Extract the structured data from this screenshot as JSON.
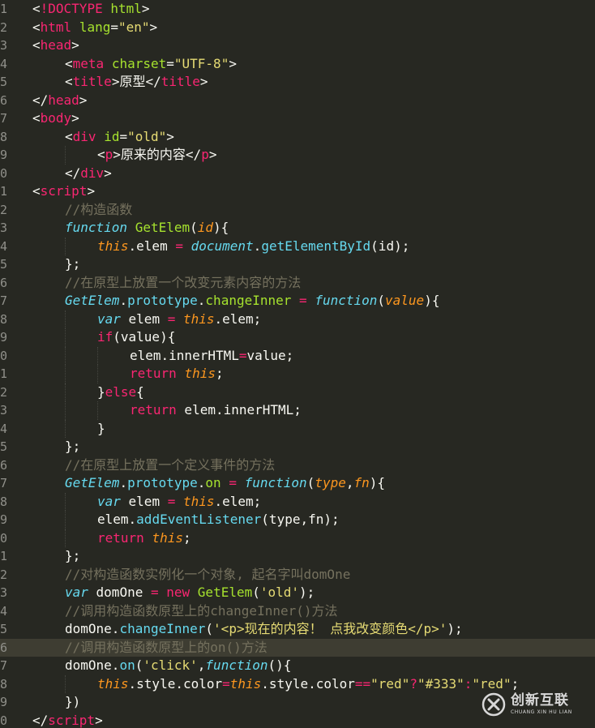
{
  "editor": {
    "theme_colors": {
      "background": "#272822",
      "active_line": "#3e3d32",
      "tag": "#f92672",
      "attribute": "#a6e22e",
      "string": "#e6db74",
      "comment": "#75715e",
      "storage": "#66d9ef",
      "parameter": "#fd971f"
    },
    "active_line_index": 35,
    "lines": [
      {
        "n": "1",
        "tokens": [
          [
            "punct",
            "<"
          ],
          [
            "tag",
            "!DOCTYPE"
          ],
          [
            "punct",
            " "
          ],
          [
            "attr",
            "html"
          ],
          [
            "punct",
            ">"
          ]
        ]
      },
      {
        "n": "2",
        "tokens": [
          [
            "punct",
            "<"
          ],
          [
            "tag",
            "html"
          ],
          [
            "punct",
            " "
          ],
          [
            "attr",
            "lang"
          ],
          [
            "punct",
            "="
          ],
          [
            "str",
            "\"en\""
          ],
          [
            "punct",
            ">"
          ]
        ]
      },
      {
        "n": "3",
        "tokens": [
          [
            "punct",
            "<"
          ],
          [
            "tag",
            "head"
          ],
          [
            "punct",
            ">"
          ]
        ]
      },
      {
        "n": "4",
        "indent": 1,
        "tokens": [
          [
            "punct",
            "<"
          ],
          [
            "tag",
            "meta"
          ],
          [
            "punct",
            " "
          ],
          [
            "attr",
            "charset"
          ],
          [
            "punct",
            "="
          ],
          [
            "str",
            "\"UTF-8\""
          ],
          [
            "punct",
            ">"
          ]
        ]
      },
      {
        "n": "5",
        "indent": 1,
        "tokens": [
          [
            "punct",
            "<"
          ],
          [
            "tag",
            "title"
          ],
          [
            "punct",
            ">原型</"
          ],
          [
            "tag",
            "title"
          ],
          [
            "punct",
            ">"
          ]
        ]
      },
      {
        "n": "6",
        "tokens": [
          [
            "punct",
            "</"
          ],
          [
            "tag",
            "head"
          ],
          [
            "punct",
            ">"
          ]
        ]
      },
      {
        "n": "7",
        "tokens": [
          [
            "punct",
            "<"
          ],
          [
            "tag",
            "body"
          ],
          [
            "punct",
            ">"
          ]
        ]
      },
      {
        "n": "8",
        "indent": 1,
        "tokens": [
          [
            "punct",
            "<"
          ],
          [
            "tag",
            "div"
          ],
          [
            "punct",
            " "
          ],
          [
            "attr",
            "id"
          ],
          [
            "punct",
            "="
          ],
          [
            "str",
            "\"old\""
          ],
          [
            "punct",
            ">"
          ]
        ]
      },
      {
        "n": "9",
        "indent": 2,
        "tokens": [
          [
            "punct",
            "<"
          ],
          [
            "tag",
            "p"
          ],
          [
            "punct",
            ">原来的内容</"
          ],
          [
            "tag",
            "p"
          ],
          [
            "punct",
            ">"
          ]
        ]
      },
      {
        "n": "0",
        "indent": 1,
        "tokens": [
          [
            "punct",
            "</"
          ],
          [
            "tag",
            "div"
          ],
          [
            "punct",
            ">"
          ]
        ]
      },
      {
        "n": "1",
        "tokens": [
          [
            "punct",
            "<"
          ],
          [
            "tag",
            "script"
          ],
          [
            "punct",
            ">"
          ]
        ]
      },
      {
        "n": "2",
        "indent": 1,
        "tokens": [
          [
            "cm",
            "//构造函数"
          ]
        ]
      },
      {
        "n": "3",
        "indent": 1,
        "tokens": [
          [
            "sto",
            "function"
          ],
          [
            "punct",
            " "
          ],
          [
            "fn",
            "GetElem"
          ],
          [
            "punct",
            "("
          ],
          [
            "param",
            "id"
          ],
          [
            "punct",
            "){"
          ]
        ]
      },
      {
        "n": "4",
        "indent": 2,
        "tokens": [
          [
            "this",
            "this"
          ],
          [
            "punct",
            ".elem "
          ],
          [
            "kw",
            "="
          ],
          [
            "punct",
            " "
          ],
          [
            "cls",
            "document"
          ],
          [
            "punct",
            "."
          ],
          [
            "sup",
            "getElementById"
          ],
          [
            "punct",
            "(id);"
          ]
        ]
      },
      {
        "n": "5",
        "indent": 1,
        "tokens": [
          [
            "punct",
            "};"
          ]
        ]
      },
      {
        "n": "6",
        "indent": 1,
        "tokens": [
          [
            "cm",
            "//在原型上放置一个改变元素内容的方法"
          ]
        ]
      },
      {
        "n": "7",
        "indent": 1,
        "tokens": [
          [
            "cls",
            "GetElem"
          ],
          [
            "punct",
            "."
          ],
          [
            "sup",
            "prototype"
          ],
          [
            "punct",
            "."
          ],
          [
            "fn",
            "changeInner"
          ],
          [
            "punct",
            " "
          ],
          [
            "kw",
            "="
          ],
          [
            "punct",
            " "
          ],
          [
            "sto",
            "function"
          ],
          [
            "punct",
            "("
          ],
          [
            "param",
            "value"
          ],
          [
            "punct",
            "){"
          ]
        ]
      },
      {
        "n": "8",
        "indent": 2,
        "tokens": [
          [
            "sto",
            "var"
          ],
          [
            "punct",
            " elem "
          ],
          [
            "kw",
            "="
          ],
          [
            "punct",
            " "
          ],
          [
            "this",
            "this"
          ],
          [
            "punct",
            ".elem;"
          ]
        ]
      },
      {
        "n": "9",
        "indent": 2,
        "tokens": [
          [
            "kw",
            "if"
          ],
          [
            "punct",
            "(value){"
          ]
        ]
      },
      {
        "n": "0",
        "indent": 3,
        "tokens": [
          [
            "punct",
            "elem.innerHTML"
          ],
          [
            "kw",
            "="
          ],
          [
            "punct",
            "value;"
          ]
        ]
      },
      {
        "n": "1",
        "indent": 3,
        "tokens": [
          [
            "kw",
            "return"
          ],
          [
            "punct",
            " "
          ],
          [
            "this",
            "this"
          ],
          [
            "punct",
            ";"
          ]
        ]
      },
      {
        "n": "2",
        "indent": 2,
        "tokens": [
          [
            "punct",
            "}"
          ],
          [
            "kw",
            "else"
          ],
          [
            "punct",
            "{"
          ]
        ]
      },
      {
        "n": "3",
        "indent": 3,
        "tokens": [
          [
            "kw",
            "return"
          ],
          [
            "punct",
            " elem.innerHTML;"
          ]
        ]
      },
      {
        "n": "4",
        "indent": 2,
        "tokens": [
          [
            "punct",
            "}"
          ]
        ]
      },
      {
        "n": "5",
        "indent": 1,
        "tokens": [
          [
            "punct",
            "};"
          ]
        ]
      },
      {
        "n": "6",
        "indent": 1,
        "tokens": [
          [
            "cm",
            "//在原型上放置一个定义事件的方法"
          ]
        ]
      },
      {
        "n": "7",
        "indent": 1,
        "tokens": [
          [
            "cls",
            "GetElem"
          ],
          [
            "punct",
            "."
          ],
          [
            "sup",
            "prototype"
          ],
          [
            "punct",
            "."
          ],
          [
            "fn",
            "on"
          ],
          [
            "punct",
            " "
          ],
          [
            "kw",
            "="
          ],
          [
            "punct",
            " "
          ],
          [
            "sto",
            "function"
          ],
          [
            "punct",
            "("
          ],
          [
            "param",
            "type"
          ],
          [
            "punct",
            ","
          ],
          [
            "param",
            "fn"
          ],
          [
            "punct",
            "){"
          ]
        ]
      },
      {
        "n": "8",
        "indent": 2,
        "tokens": [
          [
            "sto",
            "var"
          ],
          [
            "punct",
            " elem "
          ],
          [
            "kw",
            "="
          ],
          [
            "punct",
            " "
          ],
          [
            "this",
            "this"
          ],
          [
            "punct",
            ".elem;"
          ]
        ]
      },
      {
        "n": "9",
        "indent": 2,
        "tokens": [
          [
            "punct",
            "elem."
          ],
          [
            "sup",
            "addEventListener"
          ],
          [
            "punct",
            "(type,fn);"
          ]
        ]
      },
      {
        "n": "0",
        "indent": 2,
        "tokens": [
          [
            "kw",
            "return"
          ],
          [
            "punct",
            " "
          ],
          [
            "this",
            "this"
          ],
          [
            "punct",
            ";"
          ]
        ]
      },
      {
        "n": "1",
        "indent": 1,
        "tokens": [
          [
            "punct",
            "};"
          ]
        ]
      },
      {
        "n": "2",
        "indent": 1,
        "tokens": [
          [
            "cm",
            "//对构造函数实例化一个对象, 起名字叫domOne"
          ]
        ]
      },
      {
        "n": "3",
        "indent": 1,
        "tokens": [
          [
            "sto",
            "var"
          ],
          [
            "punct",
            " domOne "
          ],
          [
            "kw",
            "="
          ],
          [
            "punct",
            " "
          ],
          [
            "kw",
            "new"
          ],
          [
            "punct",
            " "
          ],
          [
            "fn",
            "GetElem"
          ],
          [
            "punct",
            "("
          ],
          [
            "str",
            "'old'"
          ],
          [
            "punct",
            ");"
          ]
        ]
      },
      {
        "n": "4",
        "indent": 1,
        "tokens": [
          [
            "cm",
            "//调用构造函数原型上的changeInner()方法"
          ]
        ]
      },
      {
        "n": "5",
        "indent": 1,
        "tokens": [
          [
            "punct",
            "domOne."
          ],
          [
            "sup",
            "changeInner"
          ],
          [
            "punct",
            "("
          ],
          [
            "str",
            "'<p>现在的内容！ 点我改变颜色</p>'"
          ],
          [
            "punct",
            ");"
          ]
        ]
      },
      {
        "n": "6",
        "indent": 1,
        "tokens": [
          [
            "cm",
            "//调用构造函数原型上的on()方法"
          ]
        ]
      },
      {
        "n": "7",
        "indent": 1,
        "tokens": [
          [
            "punct",
            "domOne."
          ],
          [
            "sup",
            "on"
          ],
          [
            "punct",
            "("
          ],
          [
            "str",
            "'click'"
          ],
          [
            "punct",
            ","
          ],
          [
            "sto",
            "function"
          ],
          [
            "punct",
            "(){"
          ]
        ]
      },
      {
        "n": "8",
        "indent": 2,
        "tokens": [
          [
            "this",
            "this"
          ],
          [
            "punct",
            ".style.color"
          ],
          [
            "kw",
            "="
          ],
          [
            "this",
            "this"
          ],
          [
            "punct",
            ".style.color"
          ],
          [
            "kw",
            "=="
          ],
          [
            "str",
            "\"red\""
          ],
          [
            "kw",
            "?"
          ],
          [
            "str",
            "\"#333\""
          ],
          [
            "kw",
            ":"
          ],
          [
            "str",
            "\"red\""
          ],
          [
            "punct",
            ";"
          ]
        ]
      },
      {
        "n": "9",
        "indent": 1,
        "tokens": [
          [
            "punct",
            "})"
          ]
        ]
      },
      {
        "n": "0",
        "tokens": [
          [
            "punct",
            "</"
          ],
          [
            "tag",
            "script"
          ],
          [
            "punct",
            ">"
          ]
        ]
      }
    ]
  },
  "watermark": {
    "title": "创新互联",
    "subtitle": "CHUANG XIN HU LIAN",
    "icon": "logo-x-icon"
  }
}
